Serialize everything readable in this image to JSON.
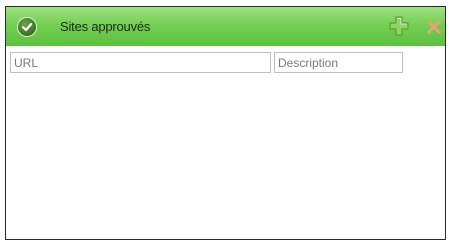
{
  "panel": {
    "title": "Sites approuvés",
    "icons": {
      "status": "check-circle-icon",
      "add": "plus-icon",
      "delete": "x-icon"
    },
    "colors": {
      "header": "#74cf55",
      "status_icon": "#3f7a27",
      "add_icon": "#8fd36a",
      "delete_icon": "#e6a37a"
    }
  },
  "grid": {
    "columns": [
      {
        "label": "URL"
      },
      {
        "label": "Description"
      }
    ],
    "rows": []
  }
}
